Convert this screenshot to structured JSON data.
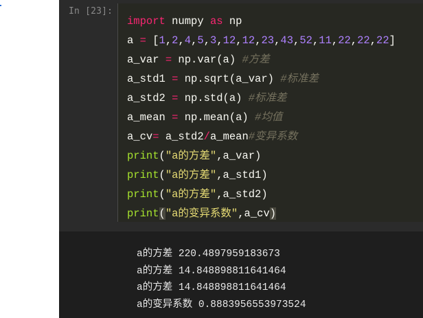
{
  "prompt": "In [23]:",
  "code": {
    "line1": {
      "kw1": "import",
      "mod": " numpy ",
      "kw2": "as",
      "alias": " np"
    },
    "line2": {
      "var": "a",
      "eq": " = ",
      "open": "[",
      "nums": [
        "1",
        "2",
        "4",
        "5",
        "3",
        "12",
        "12",
        "23",
        "43",
        "52",
        "11",
        "22",
        "22",
        "22"
      ],
      "close": "]"
    },
    "line3": {
      "lhs": "a_var",
      "eq": " = ",
      "call": "np.var(a) ",
      "comment": "#方差"
    },
    "line4": {
      "lhs": "a_std1",
      "eq": " = ",
      "call": "np.sqrt(a_var) ",
      "comment": "#标准差"
    },
    "line5": {
      "lhs": "a_std2",
      "eq": " = ",
      "call": "np.std(a) ",
      "comment": "#标准差"
    },
    "line6": {
      "lhs": "a_mean",
      "eq": " = ",
      "call": "np.mean(a) ",
      "comment": "#均值"
    },
    "line7": {
      "lhs": "a_cv",
      "eq": "=",
      "rhs1": " a_std2",
      "div": "/",
      "rhs2": "a_mean",
      "comment": "#变异系数"
    },
    "line8": {
      "fn": "print",
      "open": "(",
      "str": "\"a的方差\"",
      "rest": ",a_var)"
    },
    "line9": {
      "fn": "print",
      "open": "(",
      "str": "\"a的方差\"",
      "rest": ",a_std1)"
    },
    "line10": {
      "fn": "print",
      "open": "(",
      "str": "\"a的方差\"",
      "rest": ",a_std2)"
    },
    "line11": {
      "fn": "print",
      "open": "(",
      "str": "\"a的变异系数\"",
      "rest": ",a_cv",
      "close": ")"
    }
  },
  "output": [
    "a的方差 220.4897959183673",
    "a的方差 14.848898811641464",
    "a的方差 14.848898811641464",
    "a的变异系数 0.8883956553973524"
  ],
  "colors": {
    "keyword": "#f92672",
    "number": "#ae81ff",
    "function": "#a6e22e",
    "string": "#e6db74",
    "comment": "#75715e",
    "text": "#f8f8f2",
    "output_bg": "#1e1e1e",
    "cell_bg": "#2b2b2b"
  }
}
